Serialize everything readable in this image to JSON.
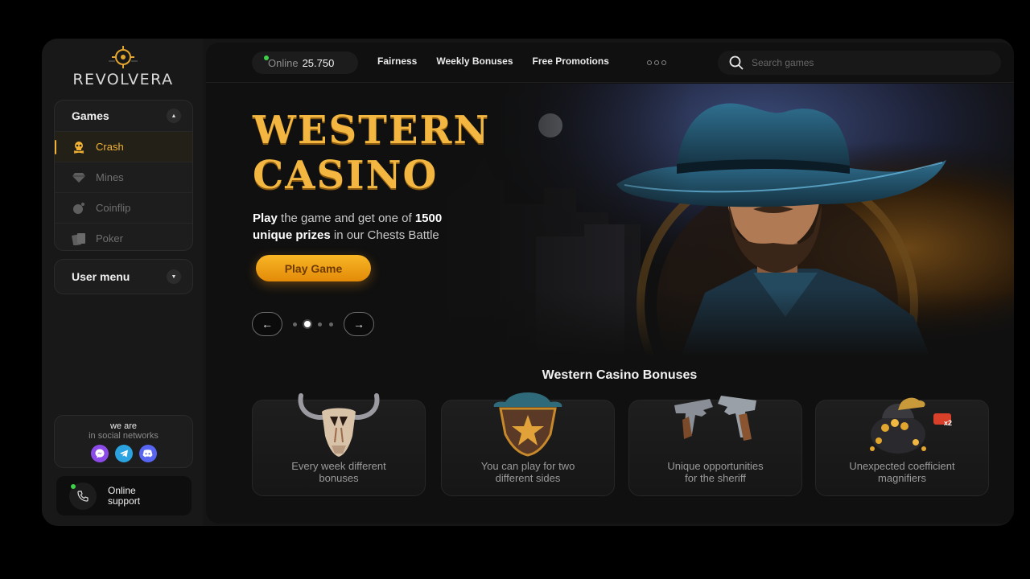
{
  "brand": {
    "name": "REVOLVERA"
  },
  "sidebar": {
    "games_label": "Games",
    "items": [
      {
        "label": "Crash",
        "icon": "skull-icon",
        "active": true
      },
      {
        "label": "Mines",
        "icon": "diamond-icon",
        "active": false
      },
      {
        "label": "Coinflip",
        "icon": "coin-icon",
        "active": false
      },
      {
        "label": "Poker",
        "icon": "cards-icon",
        "active": false
      }
    ],
    "user_menu_label": "User menu",
    "social": {
      "line1": "we are",
      "line2": "in social networks",
      "icons": [
        "messenger-icon",
        "telegram-icon",
        "discord-icon"
      ]
    },
    "support": {
      "line1": "Online",
      "line2": "support"
    }
  },
  "topbar": {
    "online_label": "Online",
    "online_count": "25.750",
    "nav": [
      "Fairness",
      "Weekly Bonuses",
      "Free Promotions"
    ],
    "search_placeholder": "Search games"
  },
  "hero": {
    "title_line1": "WESTERN",
    "title_line2": "CASINO",
    "desc": {
      "p1": "Play",
      "p2": " the game and get one of ",
      "p3": "1500",
      "p4": "unique prizes",
      "p5": " in our Chests Battle"
    },
    "cta": "Play Game",
    "prev": "←",
    "next": "→",
    "slide_count": 4,
    "active_slide": 2
  },
  "bonuses": {
    "title": "Western Casino Bonuses",
    "cards": [
      {
        "line1": "Every week different",
        "line2": "bonuses",
        "icon": "bull-skull-icon"
      },
      {
        "line1": "You can play for two",
        "line2": "different sides",
        "icon": "sheriff-badge-icon"
      },
      {
        "line1": "Unique opportunities",
        "line2": "for the sheriff",
        "icon": "revolvers-icon"
      },
      {
        "line1": "Unexpected coefficient",
        "line2": "magnifiers",
        "icon": "treasure-bag-icon",
        "badge": "x2"
      }
    ]
  },
  "colors": {
    "accent": "#f2b233",
    "online": "#3ed04a",
    "bg": "#101010"
  }
}
